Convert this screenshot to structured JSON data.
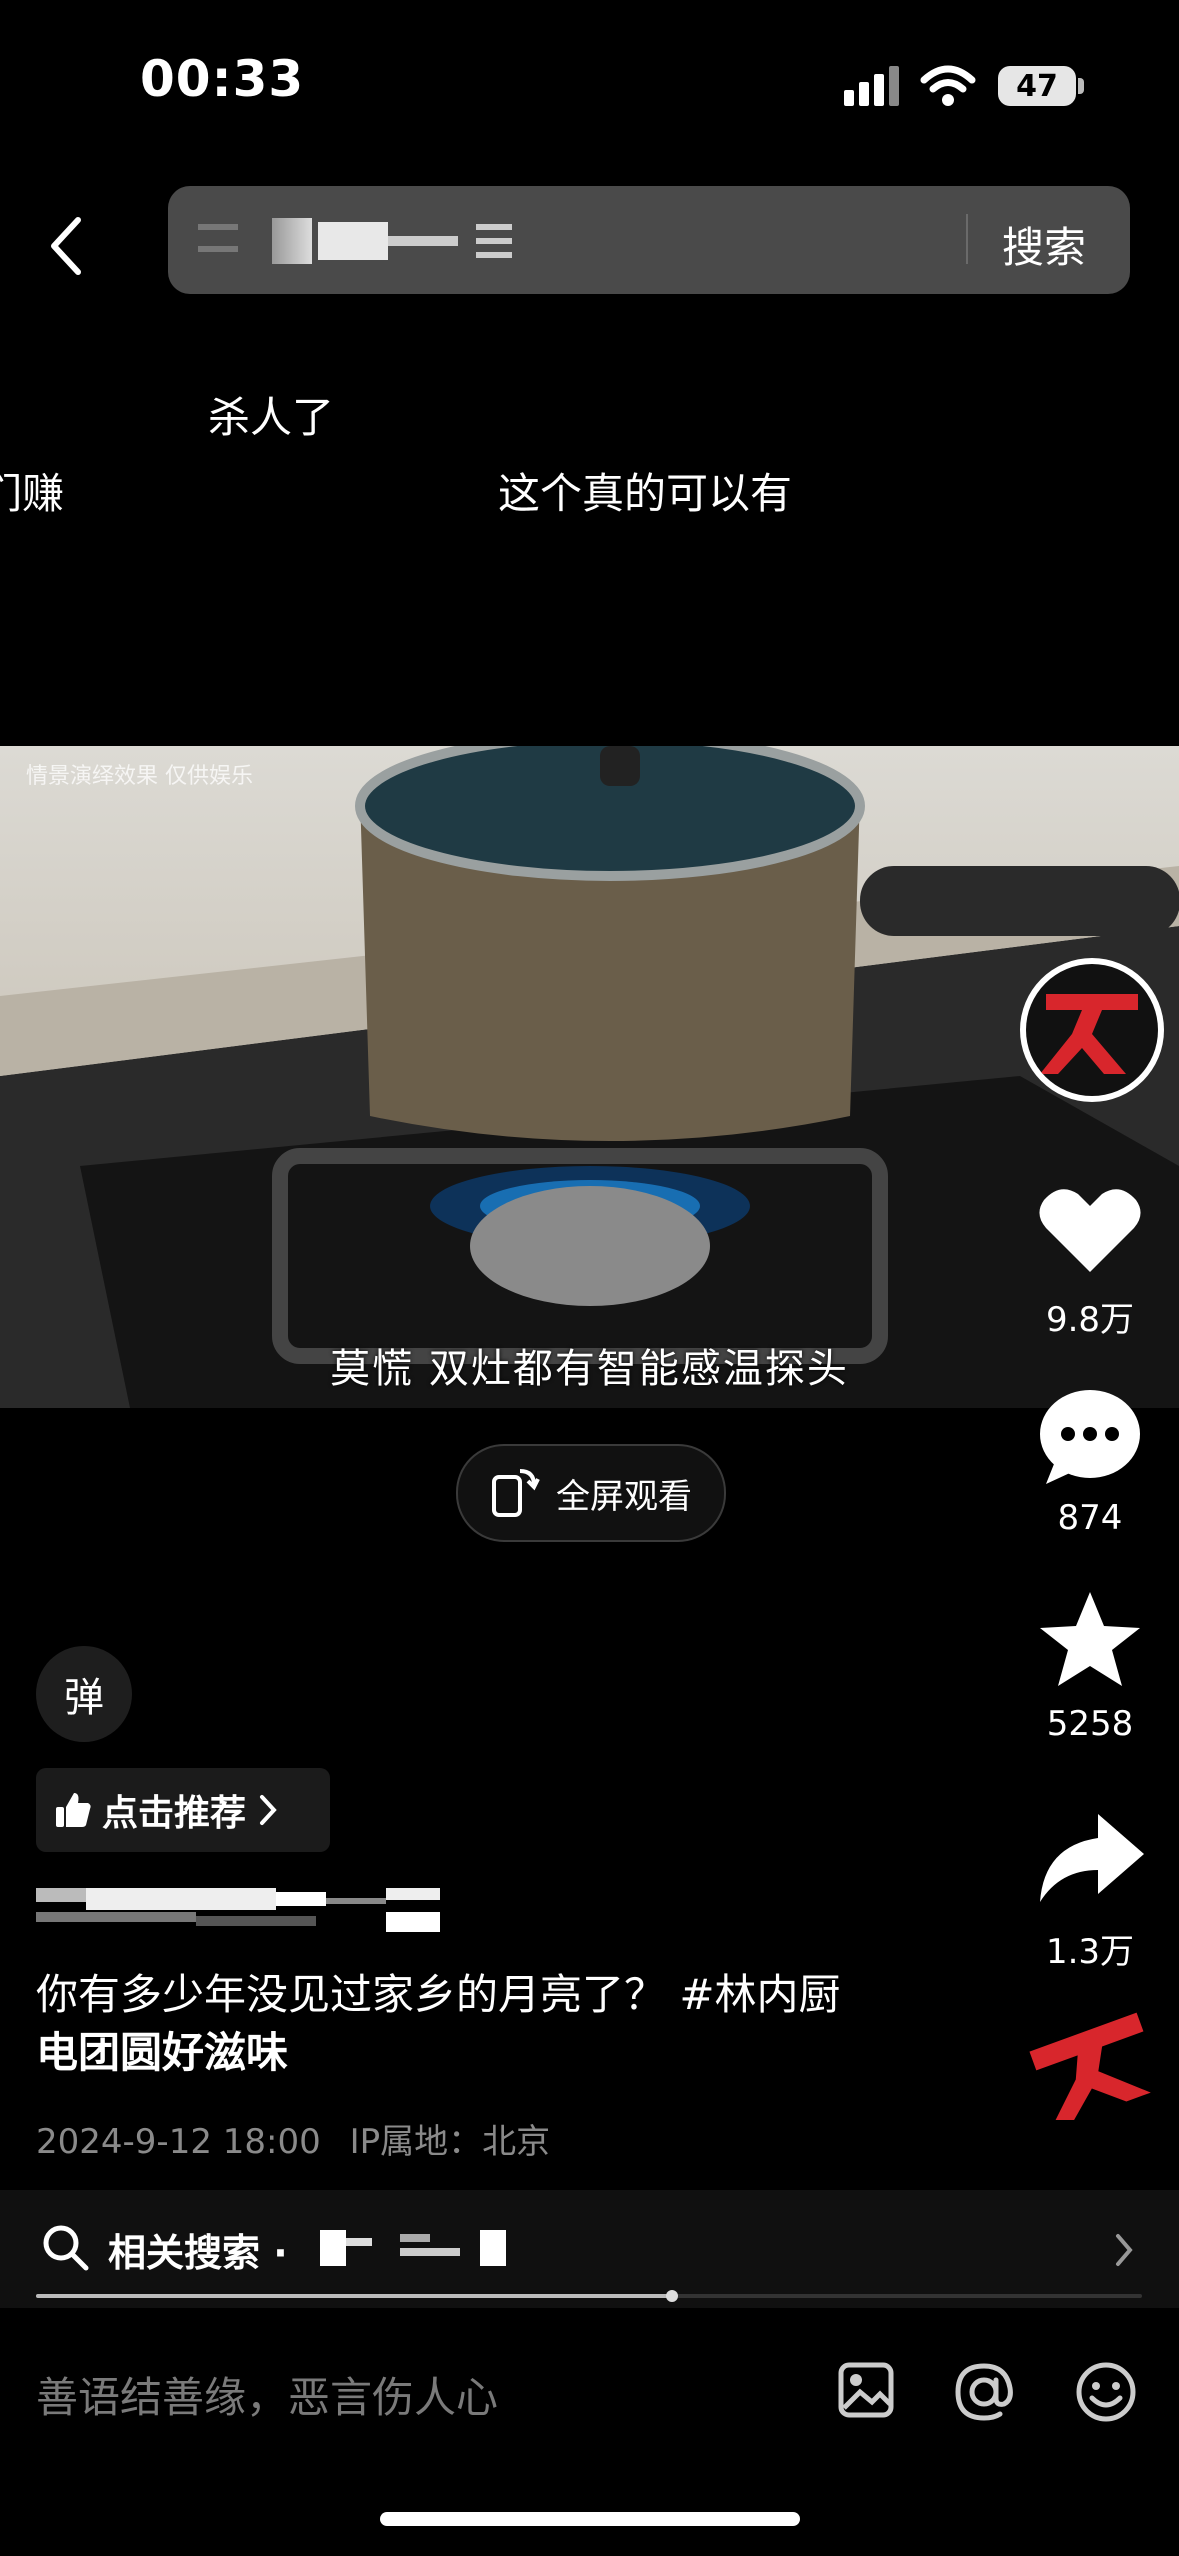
{
  "status_bar": {
    "time": "00:33",
    "battery": "47"
  },
  "search": {
    "button_label": "搜索"
  },
  "danmaku": [
    "杀人了",
    "们赚",
    "这个真的可以有"
  ],
  "video": {
    "disclaimer": "情景演绎效果 仅供娱乐",
    "subtitle": "莫慌 双灶都有智能感温探头"
  },
  "fullscreen": {
    "label": "全屏观看"
  },
  "rail": {
    "like_count": "9.8万",
    "comment_count": "874",
    "favorite_count": "5258",
    "share_count": "1.3万"
  },
  "danmu_toggle": {
    "label": "弹"
  },
  "recommend": {
    "label": "点击推荐"
  },
  "post": {
    "description_line1": "你有多少年没见过家乡的月亮了？ #林内厨",
    "description_line2": "电团圆好滋味",
    "date": "2024-9-12 18:00",
    "ip": "IP属地：北京"
  },
  "related": {
    "label": "相关搜索 ·"
  },
  "progress": {
    "played_fraction": 0.55
  },
  "comment": {
    "placeholder": "善语结善缘，恶言伤人心"
  },
  "colors": {
    "accent_red": "#d8262c",
    "background": "#000000"
  },
  "icons": [
    "back-icon",
    "wifi-icon",
    "signal-icon",
    "heart-icon",
    "comment-icon",
    "star-icon",
    "share-icon",
    "search-icon",
    "image-icon",
    "at-icon",
    "emoji-icon",
    "thumbs-up-icon",
    "rotate-screen-icon",
    "chevron-right-icon"
  ]
}
